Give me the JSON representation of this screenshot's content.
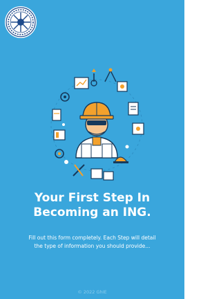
{
  "logo": {
    "name": "seal-logo-icon"
  },
  "hero": {
    "name": "engineer-illustration-icon"
  },
  "headline": {
    "line1": "Your First Step In",
    "line2": "Becoming an ING."
  },
  "subtext": {
    "line1": "Fill out this form completely. Each Step will detail",
    "line2": "the type of information you should provide..."
  },
  "footer": {
    "copyright": "© 2022 GhIE"
  },
  "colors": {
    "background": "#3aa6dc",
    "text": "#ffffff",
    "accent": "#f3a12c"
  }
}
